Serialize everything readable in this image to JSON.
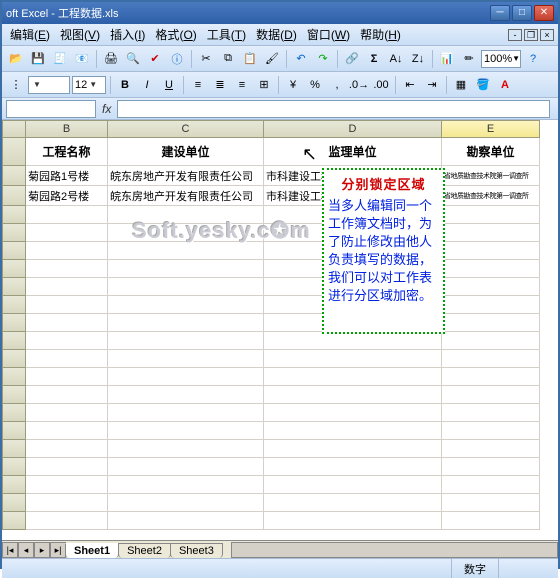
{
  "window": {
    "title": "oft Excel - 工程数据.xls"
  },
  "menus": [
    {
      "l": "编辑",
      "k": "E"
    },
    {
      "l": "视图",
      "k": "V"
    },
    {
      "l": "插入",
      "k": "I"
    },
    {
      "l": "格式",
      "k": "O"
    },
    {
      "l": "工具",
      "k": "T"
    },
    {
      "l": "数据",
      "k": "D"
    },
    {
      "l": "窗口",
      "k": "W"
    },
    {
      "l": "帮助",
      "k": "H"
    }
  ],
  "toolbar": {
    "zoom": "100%"
  },
  "format": {
    "font_size": "12"
  },
  "cols": [
    "B",
    "C",
    "D",
    "E"
  ],
  "headers": [
    "工程名称",
    "建设单位",
    "监理单位",
    "勘察单位"
  ],
  "rows": [
    [
      "菊园路1号楼",
      "皖东房地产开发有限责任公司",
      "市科建设工程监理有限责任公司",
      "省地质勘查技术院第一调查所"
    ],
    [
      "菊园路2号楼",
      "皖东房地产开发有限责任公司",
      "市科建设工程监理有限责任公司",
      "省地质勘查技术院第一调查所"
    ]
  ],
  "annotation": {
    "title": "分别锁定区域",
    "body": "当多人编辑同一个工作簿文档时，为了防止修改由他人负责填写的数据，我们可以对工作表进行分区域加密。"
  },
  "watermark": "Soft.yesky.c✪m",
  "sheets": [
    "Sheet1",
    "Sheet2",
    "Sheet3"
  ],
  "status": {
    "mode": "数字"
  }
}
